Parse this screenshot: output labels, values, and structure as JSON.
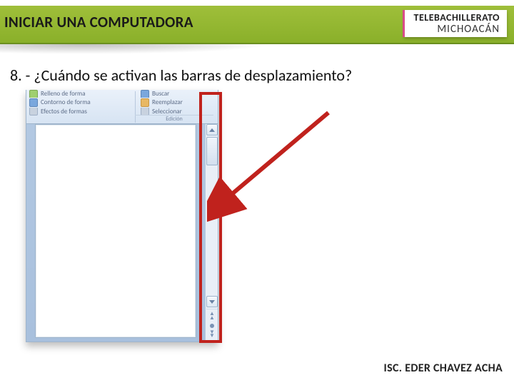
{
  "header": {
    "title": "INICIAR UNA COMPUTADORA",
    "brand_top": "TELEBACHILLERATO",
    "brand_bottom": "MICHOACÁN"
  },
  "question": "8. - ¿Cuándo se activan las barras de desplazamiento?",
  "word": {
    "ribbon_left": {
      "item1": "Relleno de forma",
      "item2": "Contorno de forma",
      "item3": "Efectos de formas"
    },
    "ribbon_right": {
      "item1": "Buscar",
      "item2": "Reemplazar",
      "item3": "Seleccionar"
    },
    "group_label_right": "Edición"
  },
  "footer": {
    "author": "ISC. EDER CHAVEZ ACHA"
  },
  "colors": {
    "accent_green": "#8ab02a",
    "highlight_red": "#c0221d"
  }
}
